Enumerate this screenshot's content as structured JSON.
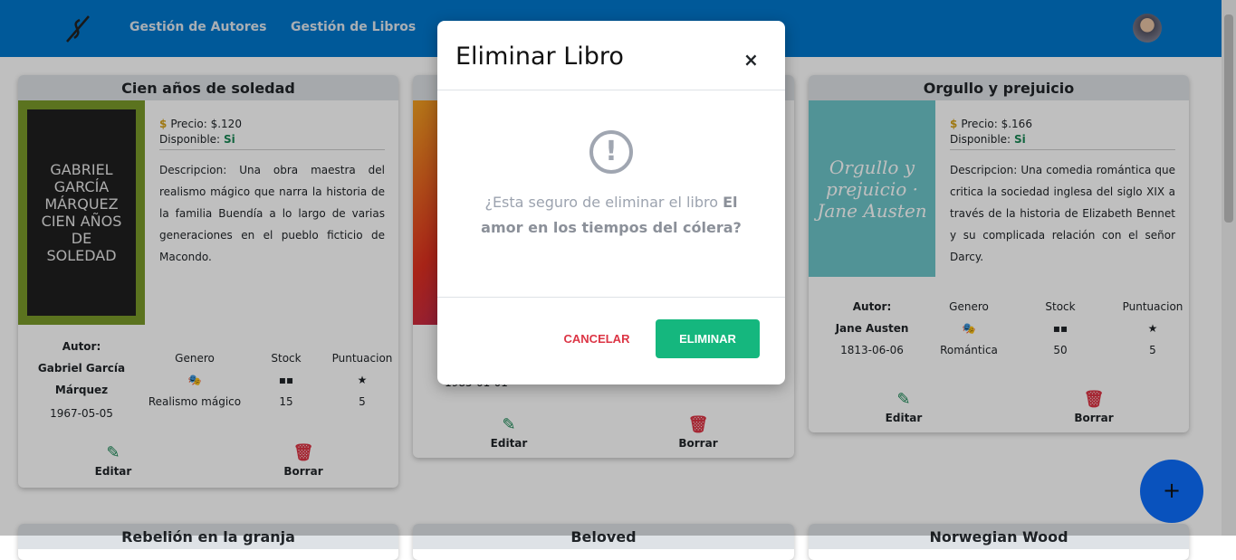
{
  "nav": {
    "links": [
      "Gestión de Autores",
      "Gestión de Libros"
    ]
  },
  "labels": {
    "price": "Precio:",
    "available": "Disponible:",
    "desc": "Descripcion:",
    "author": "Autor:",
    "genre": "Genero",
    "stock": "Stock",
    "rating": "Puntuacion",
    "edit": "Editar",
    "delete": "Borrar"
  },
  "books": [
    {
      "title": "Cien años de soledad",
      "cover_text": "GABRIEL GARCÍA MÁRQUEZ CIEN AÑOS DE SOLEDAD",
      "price": "$.120",
      "available": "Si",
      "description": "Una obra maestra del realismo mágico que narra la historia de la familia Buendía a lo largo de varias generaciones en el pueblo ficticio de Macondo.",
      "author": "Gabriel García Márquez",
      "date": "1967-05-05",
      "genre": "Realismo mágico",
      "stock": "15",
      "rating": "5"
    },
    {
      "title": "",
      "date": "1985-01-01"
    },
    {
      "title": "Orgullo y prejuicio",
      "cover_text": "Orgullo y prejuicio · Jane Austen",
      "price": "$.166",
      "available": "Si",
      "description": "Una comedia romántica que critica la sociedad inglesa del siglo XIX a través de la historia de Elizabeth Bennet y su complicada relación con el señor Darcy.",
      "author": "Jane Austen",
      "date": "1813-06-06",
      "genre": "Romántica",
      "stock": "50",
      "rating": "5"
    }
  ],
  "next_books": [
    "Rebelión en la granja",
    "Beloved",
    "Norwegian Wood"
  ],
  "fab": "+",
  "modal": {
    "title": "Eliminar Libro",
    "close": "×",
    "message": "¿Esta seguro de eliminar el libro ",
    "book": "El amor en los tiempos del cólera?",
    "cancel": "CANCELAR",
    "confirm": "ELIMINAR"
  }
}
